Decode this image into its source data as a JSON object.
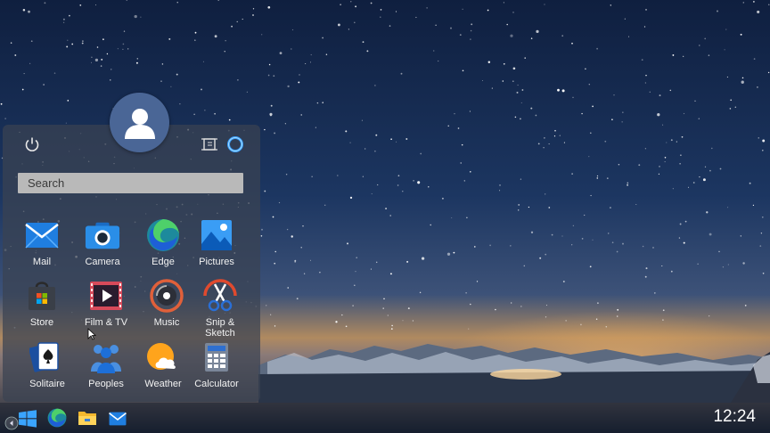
{
  "start_menu": {
    "search_placeholder": "Search",
    "apps": [
      {
        "label": "Mail",
        "icon": "mail-icon"
      },
      {
        "label": "Camera",
        "icon": "camera-icon"
      },
      {
        "label": "Edge",
        "icon": "edge-icon"
      },
      {
        "label": "Pictures",
        "icon": "pictures-icon"
      },
      {
        "label": "Store",
        "icon": "store-icon"
      },
      {
        "label": "Film & TV",
        "icon": "film-tv-icon"
      },
      {
        "label": "Music",
        "icon": "music-icon"
      },
      {
        "label": "Snip &\nSketch",
        "icon": "snip-sketch-icon"
      },
      {
        "label": "Solitaire",
        "icon": "solitaire-icon"
      },
      {
        "label": "Peoples",
        "icon": "people-icon"
      },
      {
        "label": "Weather",
        "icon": "weather-icon"
      },
      {
        "label": "Calculator",
        "icon": "calculator-icon"
      }
    ]
  },
  "taskbar": {
    "clock": "12:24",
    "pinned": [
      "windows-start-icon",
      "edge-icon",
      "file-explorer-icon",
      "mail-icon"
    ]
  },
  "colors": {
    "accent": "#1e90ff",
    "panel": "#3a4252"
  }
}
